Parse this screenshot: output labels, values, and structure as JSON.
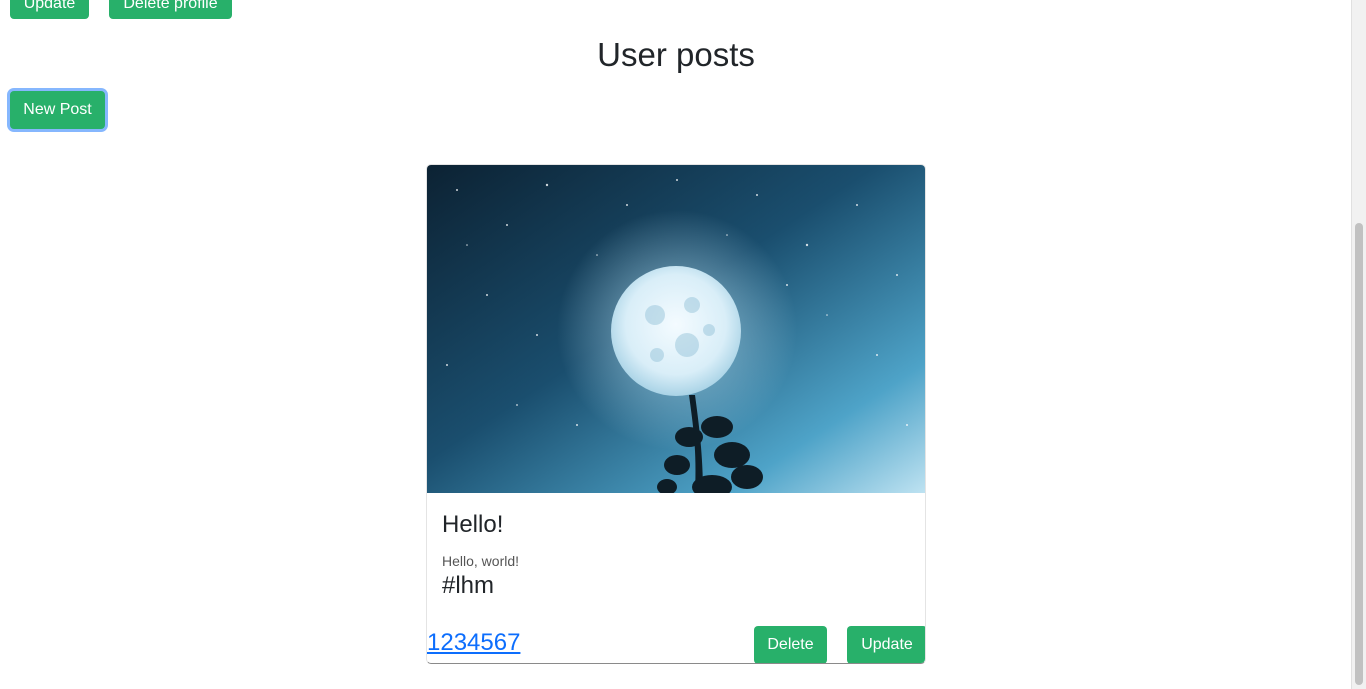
{
  "profile_actions": {
    "update_label": "Update",
    "delete_profile_label": "Delete profile"
  },
  "page_title": "User posts",
  "new_post_label": "New Post",
  "posts": [
    {
      "title": "Hello!",
      "text": "Hello, world!",
      "tag": "#lhm",
      "link": "1234567",
      "delete_label": "Delete",
      "update_label": "Update"
    }
  ],
  "colors": {
    "button_green": "#28b06a",
    "link_blue": "#0d6efd",
    "focus_ring": "#86b7fe"
  }
}
